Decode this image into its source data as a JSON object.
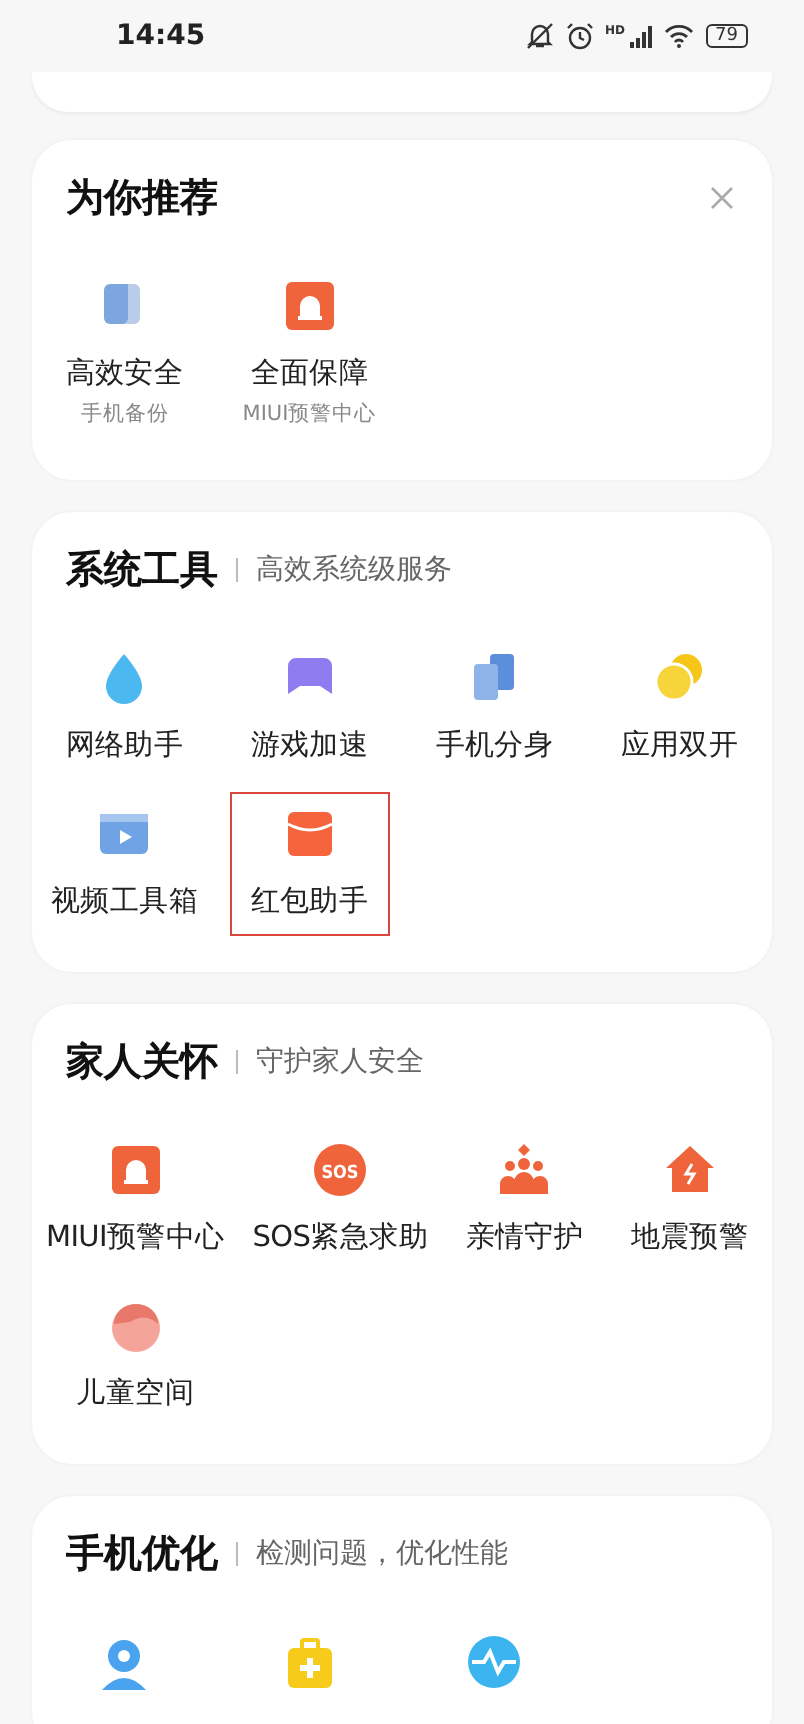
{
  "status_bar": {
    "time": "14:45",
    "signal_tag": "HD",
    "battery": "79"
  },
  "cards": [
    {
      "title": "为你推荐",
      "closable": true,
      "items": [
        {
          "kind": "copy",
          "label": "高效安全",
          "sub": "手机备份",
          "highlighted": false
        },
        {
          "kind": "alarm",
          "label": "全面保障",
          "sub": "MIUI预警中心",
          "highlighted": false
        }
      ]
    },
    {
      "title": "系统工具",
      "subtitle": "高效系统级服务",
      "items": [
        {
          "kind": "drop",
          "label": "网络助手",
          "highlighted": false
        },
        {
          "kind": "gamepad",
          "label": "游戏加速",
          "highlighted": false
        },
        {
          "kind": "clone",
          "label": "手机分身",
          "highlighted": false
        },
        {
          "kind": "coins",
          "label": "应用双开",
          "highlighted": false
        },
        {
          "kind": "video",
          "label": "视频工具箱",
          "highlighted": false
        },
        {
          "kind": "envelope",
          "label": "红包助手",
          "highlighted": true
        }
      ]
    },
    {
      "title": "家人关怀",
      "subtitle": "守护家人安全",
      "items": [
        {
          "kind": "alarm",
          "label": "MIUI预警中心",
          "highlighted": false
        },
        {
          "kind": "sos",
          "badge": "SOS",
          "label": "SOS紧急求助",
          "highlighted": false
        },
        {
          "kind": "family",
          "label": "亲情守护",
          "highlighted": false
        },
        {
          "kind": "house",
          "label": "地震预警",
          "highlighted": false
        },
        {
          "kind": "child",
          "label": "儿童空间",
          "highlighted": false
        }
      ]
    },
    {
      "title": "手机优化",
      "subtitle": "检测问题，优化性能",
      "items": [
        {
          "kind": "pin",
          "highlighted": false
        },
        {
          "kind": "medkit",
          "highlighted": false
        },
        {
          "kind": "pulse",
          "highlighted": false
        }
      ]
    }
  ]
}
